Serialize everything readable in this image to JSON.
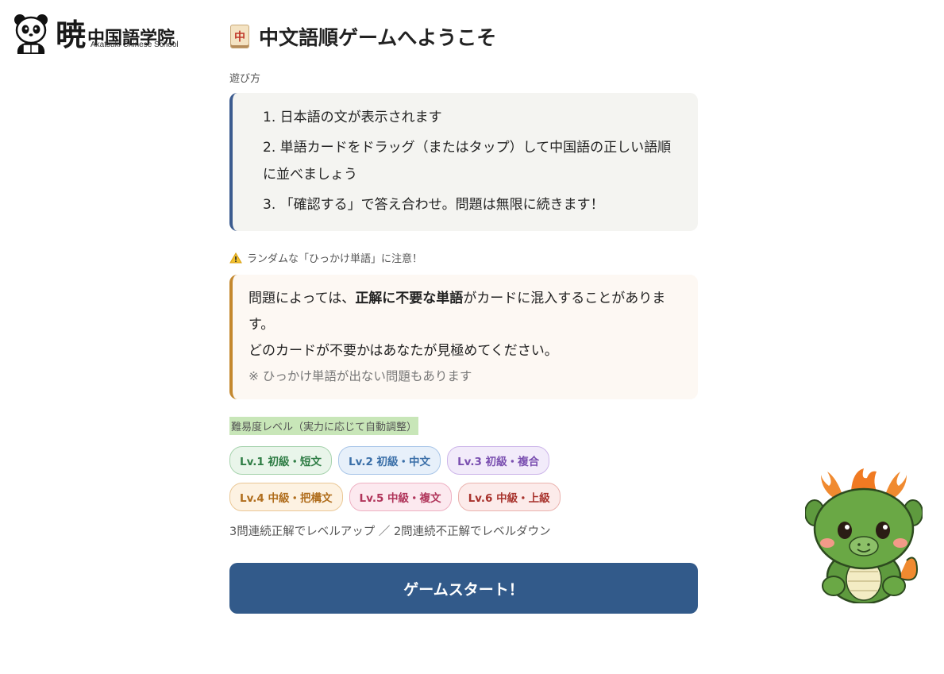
{
  "logo": {
    "big": "暁",
    "name": "中国語学院",
    "sub": "Akatsuki Chinese School"
  },
  "header": {
    "tile": "中",
    "title": "中文語順ゲームへようこそ"
  },
  "howto": {
    "label": "遊び方",
    "steps": [
      "1. 日本語の文が表示されます",
      "2. 単語カードをドラッグ（またはタップ）して中国語の正しい語順に並べましょう",
      "3. 「確認する」で答え合わせ。問題は無限に続きます！"
    ]
  },
  "warning": {
    "label": "ランダムな「ひっかけ単語」に注意！",
    "text_a": "問題によっては、",
    "text_bold": "正解に不要な単語",
    "text_b": "がカードに混入することがあります。",
    "line2": "どのカードが不要かはあなたが見極めてください。",
    "note": "※ ひっかけ単語が出ない問題もあります"
  },
  "levels": {
    "label": "難易度レベル（実力に応じて自動調整）",
    "items": [
      "Lv.1 初級・短文",
      "Lv.2 初級・中文",
      "Lv.3 初級・複合",
      "Lv.4 中級・把構文",
      "Lv.5 中級・複文",
      "Lv.6 中級・上級"
    ],
    "rule": "3問連続正解でレベルアップ ／ 2問連続不正解でレベルダウン"
  },
  "start_button": "ゲームスタート！",
  "colors": {
    "primary": "#325a8a",
    "howto_border": "#3b5b8f",
    "warn_border": "#c4882e",
    "level_highlight": "#c8e6b8"
  },
  "icons": {
    "logo": "panda-icon",
    "tile": "mahjong-tile-icon",
    "warning": "warning-triangle-icon",
    "mascot": "dragon-mascot"
  }
}
